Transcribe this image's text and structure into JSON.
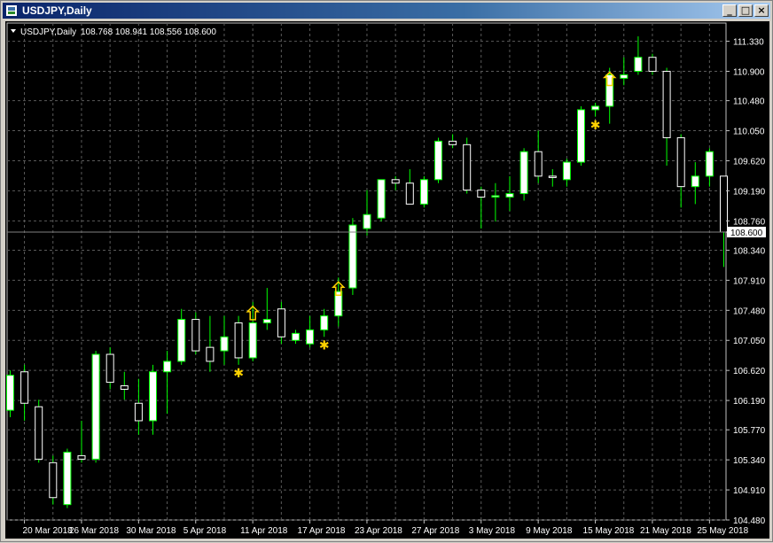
{
  "window": {
    "title": "USDJPY,Daily",
    "buttons": {
      "minimize": "_",
      "maximize": "□",
      "close": "×"
    }
  },
  "chart_header": {
    "symbol": "USDJPY,Daily",
    "ohlc": "108.768 108.941 108.556 108.600"
  },
  "colors": {
    "background": "#000000",
    "grid": "#5a5a5a",
    "bull_body": "#ffffff",
    "bear_body": "#000000",
    "wick": "#00ff00",
    "arrow": "#ffd200",
    "star": "#ffd200",
    "axis_text": "#ffffff"
  },
  "chart_data": {
    "type": "candlestick",
    "symbol": "USDJPY",
    "timeframe": "Daily",
    "current_price": 108.6,
    "ylim": [
      104.48,
      111.54
    ],
    "y_ticks": [
      "111.330",
      "110.900",
      "110.480",
      "110.050",
      "109.620",
      "109.190",
      "108.760",
      "108.340",
      "107.910",
      "107.480",
      "107.050",
      "106.620",
      "106.190",
      "105.770",
      "105.340",
      "104.910",
      "104.480"
    ],
    "x_tick_labels": [
      "20 Mar 2018",
      "26 Mar 2018",
      "30 Mar 2018",
      "5 Apr 2018",
      "11 Apr 2018",
      "17 Apr 2018",
      "23 Apr 2018",
      "27 Apr 2018",
      "3 May 2018",
      "9 May 2018",
      "15 May 2018",
      "21 May 2018",
      "25 May 2018"
    ],
    "x_tick_bar_index": [
      1,
      5,
      9,
      13,
      17,
      21,
      25,
      29,
      33,
      37,
      41,
      45,
      49
    ],
    "candles": [
      {
        "o": 106.05,
        "h": 106.62,
        "l": 105.95,
        "c": 106.55
      },
      {
        "o": 106.6,
        "h": 106.7,
        "l": 105.9,
        "c": 106.15
      },
      {
        "o": 106.1,
        "h": 106.2,
        "l": 105.3,
        "c": 105.35
      },
      {
        "o": 105.3,
        "h": 105.4,
        "l": 104.7,
        "c": 104.8
      },
      {
        "o": 104.7,
        "h": 105.5,
        "l": 104.65,
        "c": 105.45
      },
      {
        "o": 105.4,
        "h": 105.9,
        "l": 105.3,
        "c": 105.35
      },
      {
        "o": 105.35,
        "h": 106.9,
        "l": 105.3,
        "c": 106.85
      },
      {
        "o": 106.85,
        "h": 106.95,
        "l": 106.35,
        "c": 106.45
      },
      {
        "o": 106.4,
        "h": 106.6,
        "l": 106.2,
        "c": 106.35
      },
      {
        "o": 106.15,
        "h": 106.5,
        "l": 105.7,
        "c": 105.9
      },
      {
        "o": 105.9,
        "h": 106.7,
        "l": 105.7,
        "c": 106.6
      },
      {
        "o": 106.6,
        "h": 106.9,
        "l": 106.0,
        "c": 106.75
      },
      {
        "o": 106.75,
        "h": 107.5,
        "l": 106.7,
        "c": 107.35
      },
      {
        "o": 107.35,
        "h": 107.45,
        "l": 106.85,
        "c": 106.9
      },
      {
        "o": 106.95,
        "h": 107.4,
        "l": 106.6,
        "c": 106.75
      },
      {
        "o": 106.9,
        "h": 107.4,
        "l": 106.7,
        "c": 107.1
      },
      {
        "o": 107.3,
        "h": 107.4,
        "l": 106.7,
        "c": 106.8
      },
      {
        "o": 106.8,
        "h": 107.6,
        "l": 106.75,
        "c": 107.3
      },
      {
        "o": 107.3,
        "h": 107.8,
        "l": 107.2,
        "c": 107.35
      },
      {
        "o": 107.5,
        "h": 107.6,
        "l": 107.0,
        "c": 107.1
      },
      {
        "o": 107.05,
        "h": 107.2,
        "l": 107.0,
        "c": 107.15
      },
      {
        "o": 107.0,
        "h": 107.4,
        "l": 106.95,
        "c": 107.2
      },
      {
        "o": 107.2,
        "h": 107.5,
        "l": 107.1,
        "c": 107.4
      },
      {
        "o": 107.4,
        "h": 107.95,
        "l": 107.25,
        "c": 107.75
      },
      {
        "o": 107.8,
        "h": 108.8,
        "l": 107.7,
        "c": 108.7
      },
      {
        "o": 108.65,
        "h": 109.2,
        "l": 108.55,
        "c": 108.85
      },
      {
        "o": 108.8,
        "h": 109.35,
        "l": 108.75,
        "c": 109.35
      },
      {
        "o": 109.35,
        "h": 109.4,
        "l": 109.2,
        "c": 109.3
      },
      {
        "o": 109.3,
        "h": 109.5,
        "l": 109.0,
        "c": 109.0
      },
      {
        "o": 109.0,
        "h": 109.4,
        "l": 108.95,
        "c": 109.35
      },
      {
        "o": 109.35,
        "h": 109.95,
        "l": 109.3,
        "c": 109.9
      },
      {
        "o": 109.9,
        "h": 110.0,
        "l": 109.8,
        "c": 109.85
      },
      {
        "o": 109.85,
        "h": 109.95,
        "l": 109.15,
        "c": 109.2
      },
      {
        "o": 109.2,
        "h": 109.25,
        "l": 108.65,
        "c": 109.1
      },
      {
        "o": 109.1,
        "h": 109.3,
        "l": 108.75,
        "c": 109.12
      },
      {
        "o": 109.1,
        "h": 109.4,
        "l": 108.9,
        "c": 109.15
      },
      {
        "o": 109.15,
        "h": 109.8,
        "l": 109.05,
        "c": 109.75
      },
      {
        "o": 109.75,
        "h": 110.05,
        "l": 109.3,
        "c": 109.4
      },
      {
        "o": 109.4,
        "h": 109.5,
        "l": 109.25,
        "c": 109.38
      },
      {
        "o": 109.35,
        "h": 109.65,
        "l": 109.25,
        "c": 109.6
      },
      {
        "o": 109.6,
        "h": 110.4,
        "l": 109.55,
        "c": 110.35
      },
      {
        "o": 110.35,
        "h": 110.45,
        "l": 110.25,
        "c": 110.4
      },
      {
        "o": 110.4,
        "h": 110.95,
        "l": 110.15,
        "c": 110.85
      },
      {
        "o": 110.8,
        "h": 111.1,
        "l": 110.7,
        "c": 110.85
      },
      {
        "o": 110.9,
        "h": 111.4,
        "l": 110.85,
        "c": 111.1
      },
      {
        "o": 111.1,
        "h": 111.15,
        "l": 110.85,
        "c": 110.9
      },
      {
        "o": 110.9,
        "h": 110.95,
        "l": 109.55,
        "c": 109.95
      },
      {
        "o": 109.95,
        "h": 110.0,
        "l": 108.95,
        "c": 109.25
      },
      {
        "o": 109.25,
        "h": 109.6,
        "l": 109.0,
        "c": 109.4
      },
      {
        "o": 109.4,
        "h": 109.8,
        "l": 109.25,
        "c": 109.75
      },
      {
        "o": 109.4,
        "h": 109.4,
        "l": 108.1,
        "c": 108.6
      }
    ],
    "up_arrows": [
      17,
      23,
      42
    ],
    "stars": [
      16,
      22,
      41
    ]
  }
}
